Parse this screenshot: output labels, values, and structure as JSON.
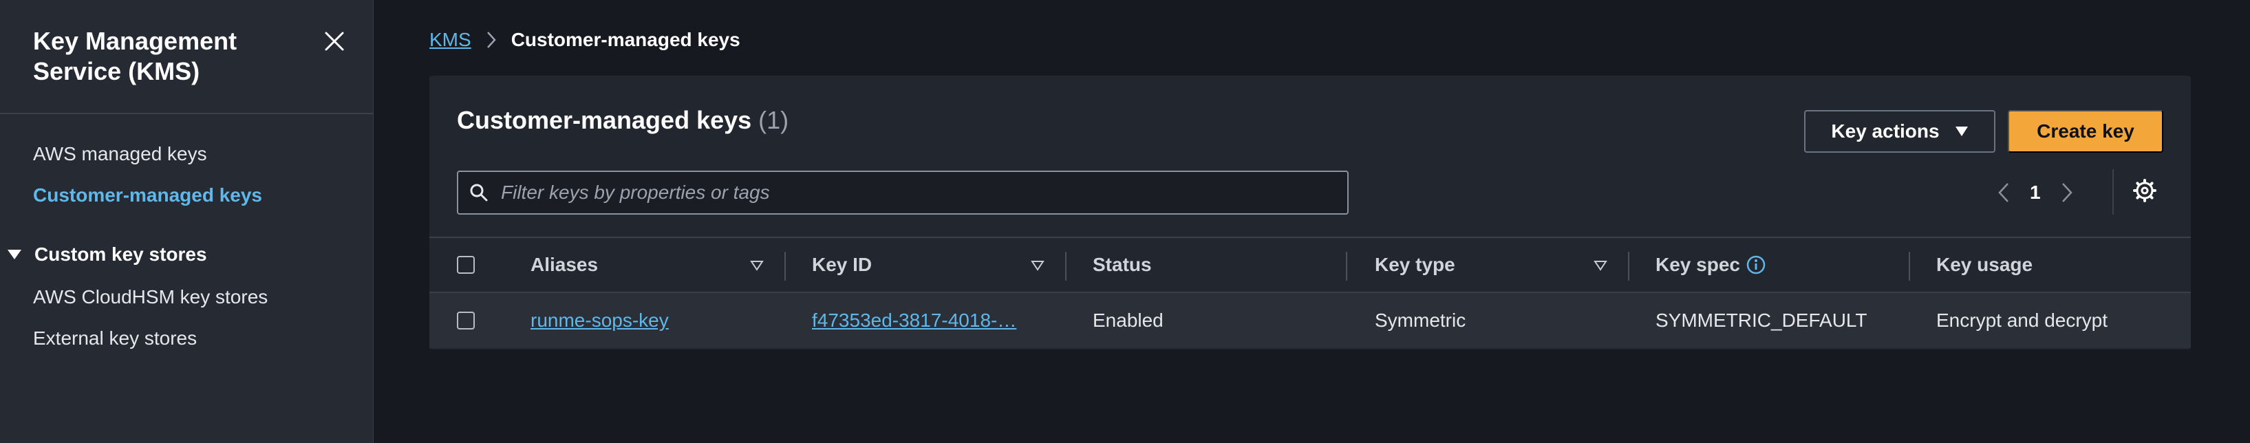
{
  "sidebar": {
    "title": "Key Management Service (KMS)",
    "close_icon": "close-icon",
    "items": [
      {
        "label": "AWS managed keys",
        "active": false
      },
      {
        "label": "Customer-managed keys",
        "active": true
      }
    ],
    "section": {
      "label": "Custom key stores",
      "expanded": true
    },
    "section_items": [
      {
        "label": "AWS CloudHSM key stores"
      },
      {
        "label": "External key stores"
      }
    ]
  },
  "breadcrumb": {
    "root": "KMS",
    "current": "Customer-managed keys"
  },
  "panel": {
    "title": "Customer-managed keys",
    "count": "(1)",
    "key_actions_label": "Key actions",
    "create_label": "Create key",
    "search_placeholder": "Filter keys by properties or tags",
    "page": "1"
  },
  "table": {
    "columns": [
      "Aliases",
      "Key ID",
      "Status",
      "Key type",
      "Key spec",
      "Key usage"
    ],
    "rows": [
      {
        "alias": "runme-sops-key",
        "key_id": "f47353ed-3817-4018-…",
        "status": "Enabled",
        "key_type": "Symmetric",
        "key_spec": "SYMMETRIC_DEFAULT",
        "key_usage": "Encrypt and decrypt"
      }
    ]
  },
  "colors": {
    "accent_link": "#5fb8e9",
    "primary_button": "#f3a73b",
    "background": "#16191f",
    "sidebar": "#262a33"
  }
}
